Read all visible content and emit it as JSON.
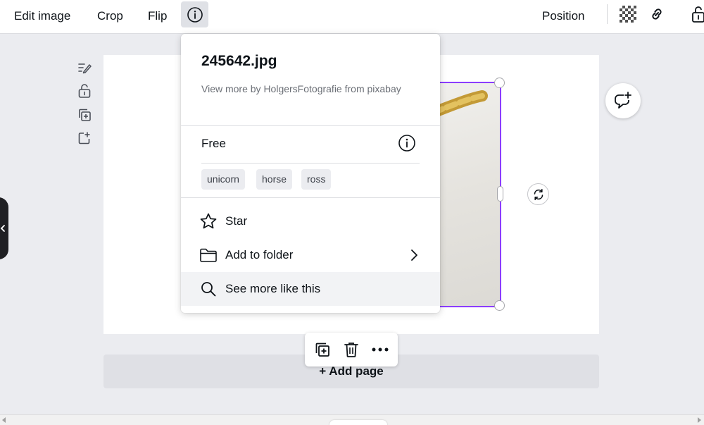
{
  "toolbar": {
    "edit_image": "Edit image",
    "crop": "Crop",
    "flip": "Flip",
    "info_icon": "info-icon",
    "position": "Position",
    "transparency_icon": "transparency-icon",
    "link_icon": "link-icon",
    "lock_icon": "unlock-icon"
  },
  "side_rail": {
    "icons": [
      "notes-icon",
      "unlock-icon",
      "duplicate-icon",
      "add-page-icon"
    ]
  },
  "canvas": {
    "add_page_label": "+ Add page",
    "comment_icon": "add-comment-icon",
    "rotate_icon": "rotate-icon"
  },
  "mini_toolbar": {
    "icons": [
      "duplicate-icon",
      "trash-icon",
      "more-icon"
    ]
  },
  "info_popover": {
    "title": "245642.jpg",
    "credit": "View more by HolgersFotografie from pixabay",
    "license": "Free",
    "tags": [
      "unicorn",
      "horse",
      "ross"
    ],
    "actions": [
      {
        "label": "Star",
        "icon": "star-icon"
      },
      {
        "label": "Add to folder",
        "icon": "folder-icon"
      },
      {
        "label": "See more like this",
        "icon": "search-icon"
      }
    ]
  },
  "colors": {
    "selection": "#8b3dff",
    "background": "#ebecf0",
    "text": "#0e1318"
  }
}
